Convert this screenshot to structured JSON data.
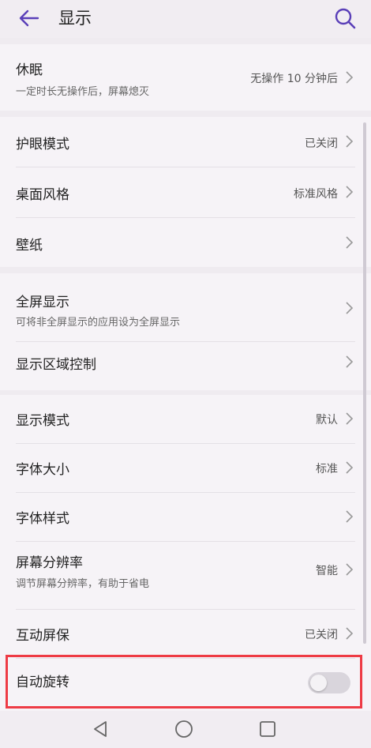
{
  "header": {
    "title": "显示"
  },
  "settings": {
    "sleep": {
      "label": "休眠",
      "sub": "一定时长无操作后，屏幕熄灭",
      "value": "无操作 10 分钟后"
    },
    "eye_comfort": {
      "label": "护眼模式",
      "value": "已关闭"
    },
    "home_style": {
      "label": "桌面风格",
      "value": "标准风格"
    },
    "wallpaper": {
      "label": "壁纸"
    },
    "full_screen": {
      "label": "全屏显示",
      "sub": "可将非全屏显示的应用设为全屏显示"
    },
    "display_area": {
      "label": "显示区域控制"
    },
    "display_mode": {
      "label": "显示模式",
      "value": "默认"
    },
    "font_size": {
      "label": "字体大小",
      "value": "标准"
    },
    "font_style": {
      "label": "字体样式"
    },
    "resolution": {
      "label": "屏幕分辨率",
      "sub": "调节屏幕分辨率，有助于省电",
      "value": "智能"
    },
    "screensaver": {
      "label": "互动屏保",
      "value": "已关闭"
    },
    "auto_rotate": {
      "label": "自动旋转",
      "enabled": false
    }
  },
  "colors": {
    "accent": "#5a3fb8",
    "highlight": "#ee3b45"
  },
  "icons": {
    "back": "back-arrow-icon",
    "search": "search-icon",
    "chevron": "chevron-right-icon",
    "nav_back": "triangle-back-icon",
    "nav_home": "circle-home-icon",
    "nav_recent": "square-recent-icon"
  }
}
